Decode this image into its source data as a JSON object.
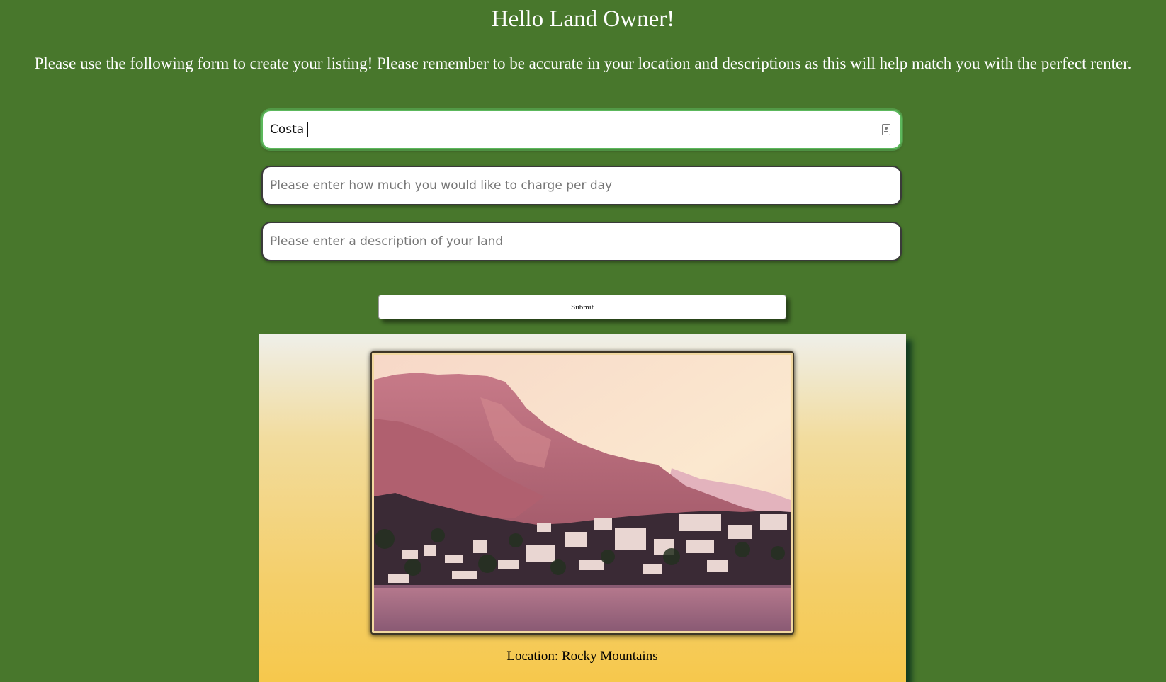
{
  "header": {
    "title": "Hello Land Owner!",
    "subtitle": "Please use the following form to create your listing! Please remember to be accurate in your location and descriptions as this will help match you with the perfect renter."
  },
  "form": {
    "location_value": "Costa",
    "price_placeholder": "Please enter how much you would like to charge per day",
    "description_placeholder": "Please enter a description of your land",
    "submit_label": "Submit"
  },
  "listing_card": {
    "image_icon": "coastal-town-photo",
    "location_text": "Location: Rocky Mountains"
  },
  "colors": {
    "background": "#48772c",
    "focus_ring": "#5cb85c"
  }
}
